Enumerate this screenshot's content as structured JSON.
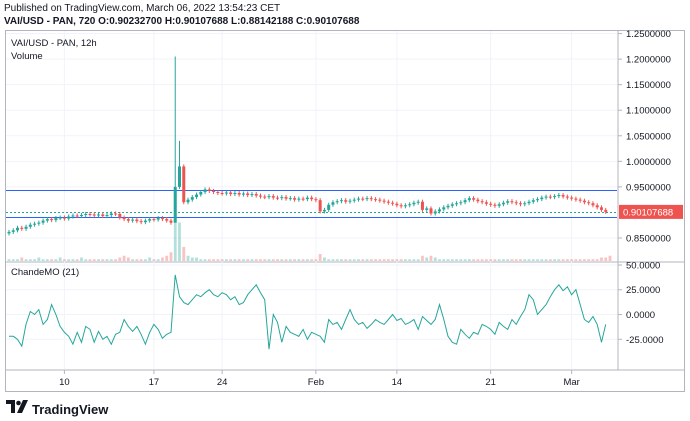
{
  "header": {
    "published": "Published on TradingView.com, March 06, 2022 13:54:23 CET",
    "symbol_line": "VAI/USD - PAN, 720",
    "ohlc": "O:0.90232700 H:0.90107688 L:0.88142188 C:0.90107688"
  },
  "main_pane": {
    "title": "VAI/USD - PAN, 12h",
    "volume_label": "Volume"
  },
  "osc_pane": {
    "title": "ChandeMO (21)"
  },
  "footer": {
    "brand": "TradingView"
  },
  "chart_data": [
    {
      "type": "candlestick",
      "title": "VAI/USD - PAN, 12h",
      "price_axis_ticks": [
        "1.2500000",
        "1.2000000",
        "1.1500000",
        "1.1000000",
        "1.0500000",
        "1.0000000",
        "0.9500000",
        "0.90107688",
        "0.8500000"
      ],
      "ylim": [
        0.805,
        1.255
      ],
      "x_ticks": [
        "10",
        "17",
        "24",
        "Feb",
        "14",
        "21",
        "Mar"
      ],
      "last_price_label": "0.90107688",
      "horizontal_lines": [
        0.943,
        0.9,
        0.89
      ],
      "close_series": [
        0.862,
        0.865,
        0.87,
        0.868,
        0.872,
        0.876,
        0.878,
        0.88,
        0.884,
        0.887,
        0.885,
        0.889,
        0.89,
        0.888,
        0.892,
        0.894,
        0.893,
        0.895,
        0.897,
        0.896,
        0.894,
        0.896,
        0.893,
        0.895,
        0.898,
        0.897,
        0.89,
        0.887,
        0.884,
        0.886,
        0.883,
        0.881,
        0.884,
        0.887,
        0.886,
        0.889,
        0.887,
        0.884,
        0.88,
        0.95,
        0.99,
        0.92,
        0.925,
        0.93,
        0.935,
        0.94,
        0.945,
        0.942,
        0.94,
        0.938,
        0.937,
        0.939,
        0.936,
        0.938,
        0.935,
        0.937,
        0.934,
        0.936,
        0.933,
        0.931,
        0.93,
        0.932,
        0.929,
        0.928,
        0.93,
        0.927,
        0.928,
        0.925,
        0.927,
        0.926,
        0.929,
        0.926,
        0.924,
        0.902,
        0.905,
        0.915,
        0.92,
        0.922,
        0.924,
        0.921,
        0.923,
        0.925,
        0.927,
        0.926,
        0.928,
        0.926,
        0.925,
        0.923,
        0.921,
        0.919,
        0.917,
        0.914,
        0.912,
        0.914,
        0.916,
        0.919,
        0.921,
        0.905,
        0.908,
        0.898,
        0.902,
        0.906,
        0.91,
        0.913,
        0.916,
        0.918,
        0.92,
        0.924,
        0.928,
        0.925,
        0.922,
        0.92,
        0.917,
        0.915,
        0.913,
        0.916,
        0.919,
        0.922,
        0.92,
        0.918,
        0.916,
        0.918,
        0.921,
        0.924,
        0.926,
        0.929,
        0.931,
        0.93,
        0.932,
        0.934,
        0.931,
        0.929,
        0.927,
        0.925,
        0.923,
        0.92,
        0.918,
        0.914,
        0.91,
        0.905,
        0.901
      ],
      "volume_series": [
        1,
        1,
        1,
        2,
        1,
        1,
        1,
        2,
        1,
        1,
        1,
        1,
        2,
        1,
        1,
        1,
        1,
        2,
        1,
        1,
        1,
        1,
        1,
        1,
        1,
        1,
        2,
        3,
        2,
        1,
        1,
        1,
        1,
        2,
        1,
        1,
        2,
        3,
        5,
        40,
        22,
        8,
        3,
        2,
        2,
        1,
        1,
        1,
        1,
        1,
        1,
        1,
        1,
        1,
        1,
        1,
        1,
        1,
        1,
        1,
        1,
        1,
        1,
        1,
        1,
        1,
        1,
        1,
        1,
        1,
        1,
        1,
        1,
        4,
        2,
        1,
        1,
        1,
        1,
        1,
        1,
        1,
        1,
        1,
        1,
        1,
        1,
        1,
        1,
        1,
        1,
        1,
        1,
        1,
        1,
        1,
        1,
        3,
        2,
        3,
        2,
        1,
        1,
        1,
        1,
        1,
        1,
        1,
        1,
        1,
        1,
        1,
        1,
        1,
        1,
        1,
        1,
        1,
        1,
        1,
        1,
        1,
        1,
        1,
        1,
        1,
        1,
        1,
        1,
        1,
        1,
        1,
        1,
        1,
        1,
        1,
        1,
        1,
        1,
        2,
        2,
        3
      ]
    },
    {
      "type": "line",
      "title": "ChandeMO (21)",
      "y_ticks": [
        "50.0000",
        "25.0000",
        "0.0000",
        "-25.0000"
      ],
      "ylim": [
        -55,
        52
      ],
      "series": [
        {
          "values": [
            -22,
            -22,
            -25,
            -32,
            -10,
            3,
            0,
            5,
            -10,
            -5,
            10,
            0,
            -12,
            -18,
            -22,
            -30,
            -18,
            -28,
            -12,
            -15,
            -28,
            -17,
            -25,
            -22,
            -30,
            -20,
            -18,
            -5,
            -12,
            -17,
            -12,
            -20,
            -30,
            -18,
            -10,
            -15,
            -24,
            -20,
            -18,
            40,
            18,
            12,
            10,
            15,
            20,
            18,
            22,
            25,
            20,
            18,
            22,
            20,
            15,
            18,
            10,
            12,
            20,
            25,
            30,
            22,
            15,
            -35,
            0,
            -8,
            -28,
            -12,
            -18,
            -20,
            -22,
            -15,
            -25,
            -18,
            -20,
            -22,
            -28,
            -5,
            -10,
            -8,
            -15,
            -5,
            5,
            -5,
            -10,
            -8,
            -14,
            -10,
            -5,
            -8,
            -10,
            -5,
            0,
            -6,
            -4,
            -10,
            -8,
            -5,
            -15,
            -2,
            -6,
            -10,
            -5,
            10,
            -5,
            -22,
            -28,
            -30,
            -15,
            -20,
            -24,
            -18,
            -20,
            -10,
            -12,
            -15,
            -20,
            -8,
            -12,
            -15,
            -5,
            -10,
            -2,
            5,
            20,
            15,
            0,
            5,
            10,
            18,
            25,
            30,
            24,
            28,
            20,
            25,
            10,
            -5,
            -8,
            -2,
            -10,
            -28,
            -10
          ]
        }
      ]
    }
  ]
}
